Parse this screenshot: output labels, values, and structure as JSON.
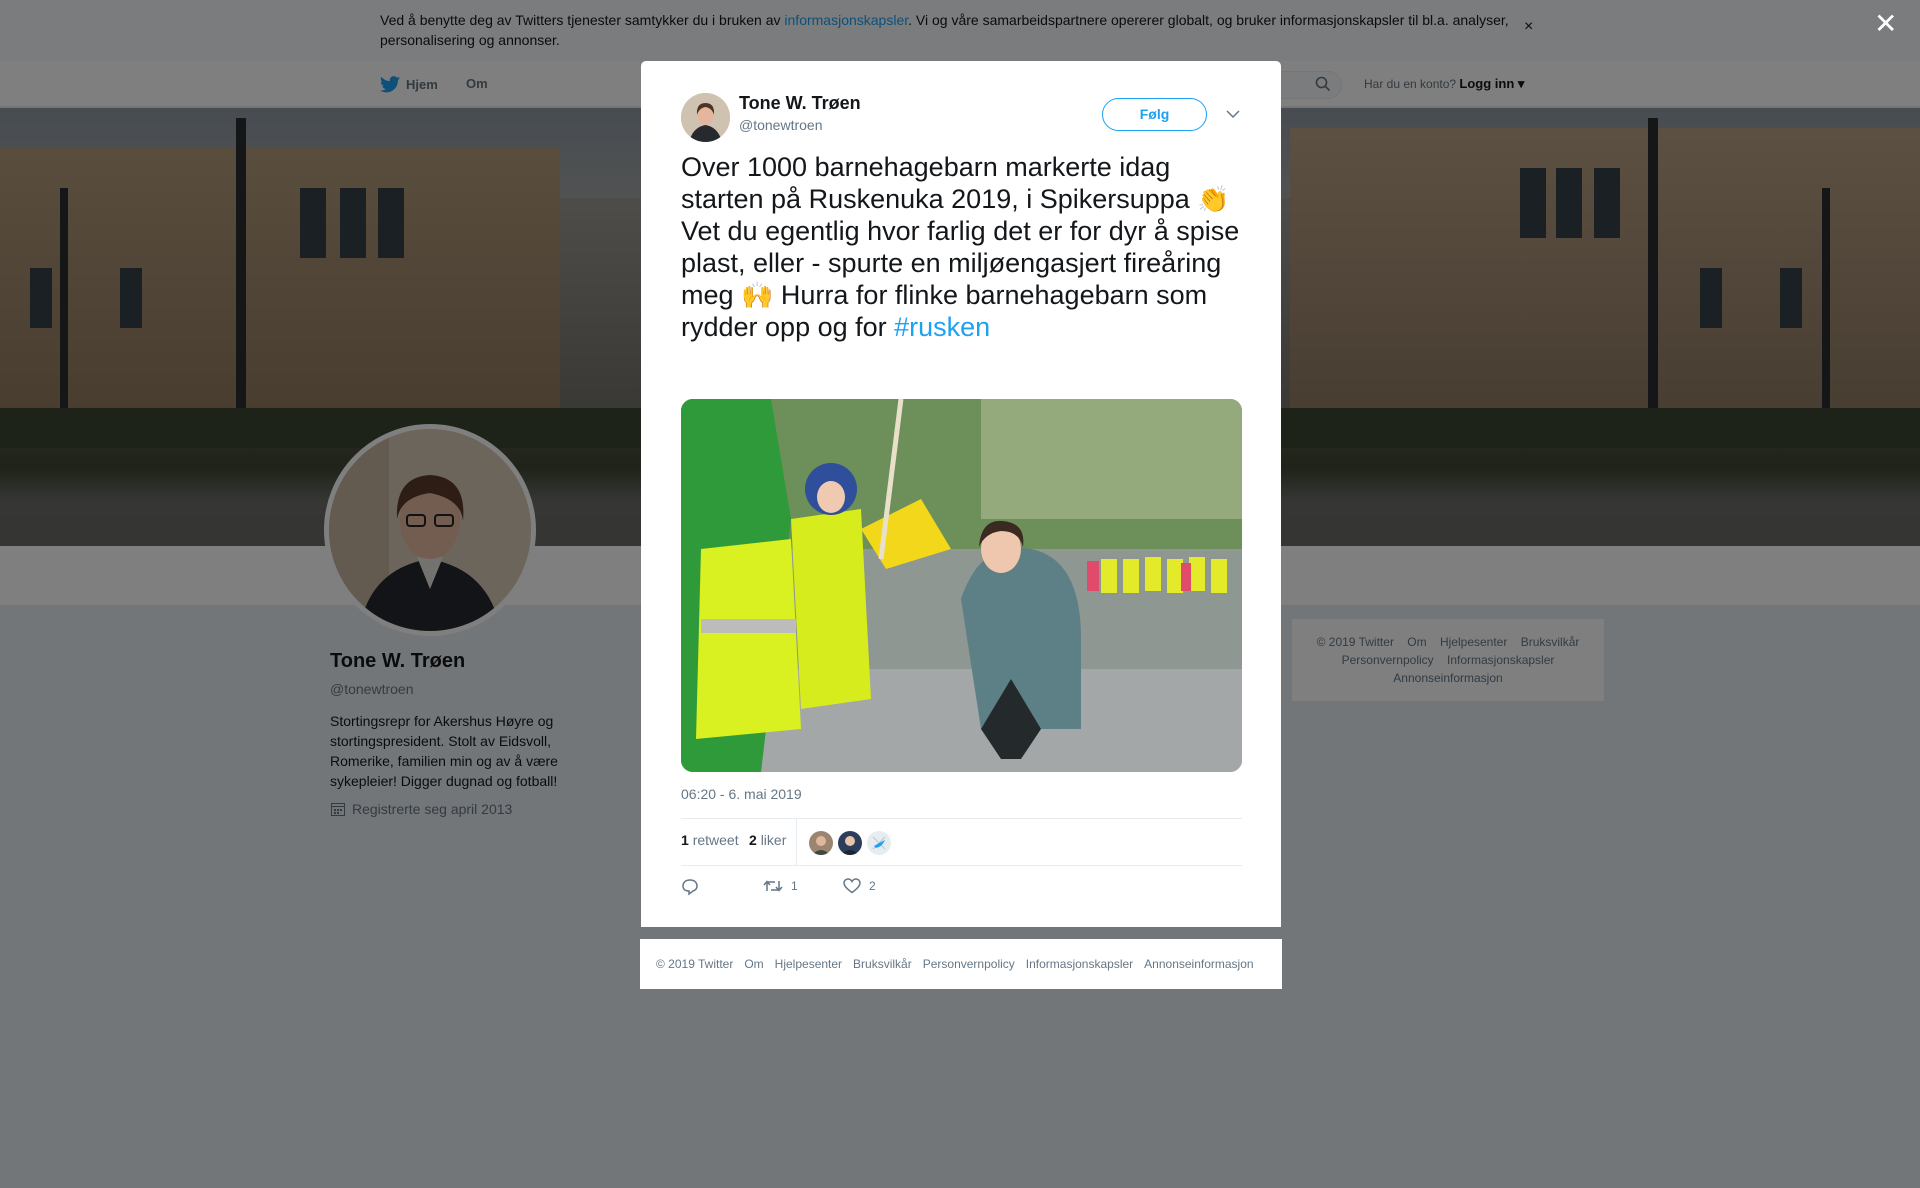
{
  "cookie": {
    "text_before": "Ved å benytte deg av Twitters tjenester samtykker du i bruken av ",
    "link": "informasjonskapsler",
    "text_after": ". Vi og våre samarbeidspartnere opererer globalt, og bruker informasjonskapsler til bl.a. analyser, personalisering og annonser.",
    "close": "×"
  },
  "nav": {
    "home": "Hjem",
    "about": "Om",
    "have_account": "Har du en konto?",
    "login": "Logg inn"
  },
  "profile": {
    "name": "Tone W. Trøen",
    "handle": "@tonewtroen",
    "bio": "Stortingsrepr for Akershus Høyre og stortingspresident. Stolt av Eidsvoll, Romerike, familien min og av å være sykepleier! Digger dugnad og fotball!",
    "joined": "Registrerte seg april 2013"
  },
  "side_footer": {
    "row1": [
      "© 2019 Twitter",
      "Om",
      "Hjelpesenter",
      "Bruksvilkår"
    ],
    "row2": [
      "Personvernpolicy",
      "Informasjonskapsler"
    ],
    "row3": [
      "Annonseinformasjon"
    ]
  },
  "overlay": {
    "close": "✕"
  },
  "tweet": {
    "name": "Tone W. Trøen",
    "handle": "@tonewtroen",
    "follow": "Følg",
    "text_part1": "Over 1000 barnehagebarn markerte idag starten på Ruskenuka 2019, i Spikersuppa ",
    "emoji1": "👏",
    "text_part2": " Vet du egentlig hvor farlig det er for dyr å spise plast, eller - spurte en miljøengasjert fireåring meg ",
    "emoji2": "🙌",
    "text_part3": " Hurra for flinke barnehagebarn som rydder opp og for ",
    "hashtag": "#rusken",
    "timestamp": "06:20 - 6. mai 2019",
    "retweets_count": "1",
    "retweets_label": "retweet",
    "likes_count": "2",
    "likes_label": "liker",
    "action_retweet_count": "1",
    "action_like_count": "2"
  },
  "modal_footer": [
    "© 2019 Twitter",
    "Om",
    "Hjelpesenter",
    "Bruksvilkår",
    "Personvernpolicy",
    "Informasjonskapsler",
    "Annonseinformasjon"
  ],
  "colors": {
    "accent": "#1da1f2",
    "overlay": "rgba(0,0,0,0.5)"
  }
}
